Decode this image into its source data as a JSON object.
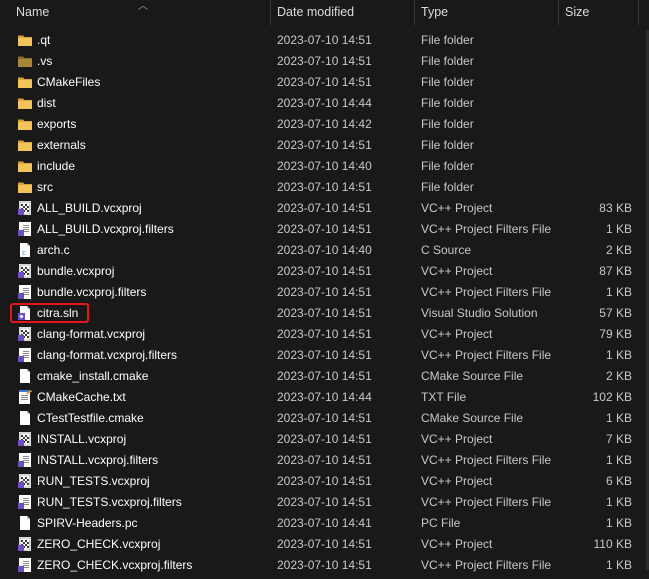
{
  "columns": {
    "name": "Name",
    "date": "Date modified",
    "type": "Type",
    "size": "Size"
  },
  "colors": {
    "folder": "#e8b84a",
    "highlight": "#e8141c",
    "vcxproj": "#6e4fc2"
  },
  "files": [
    {
      "name": ".qt",
      "date": "2023-07-10 14:51",
      "type": "File folder",
      "size": "",
      "icon": "folder-icon"
    },
    {
      "name": ".vs",
      "date": "2023-07-10 14:51",
      "type": "File folder",
      "size": "",
      "icon": "folder-dark-icon"
    },
    {
      "name": "CMakeFiles",
      "date": "2023-07-10 14:51",
      "type": "File folder",
      "size": "",
      "icon": "folder-icon"
    },
    {
      "name": "dist",
      "date": "2023-07-10 14:44",
      "type": "File folder",
      "size": "",
      "icon": "folder-icon"
    },
    {
      "name": "exports",
      "date": "2023-07-10 14:42",
      "type": "File folder",
      "size": "",
      "icon": "folder-icon"
    },
    {
      "name": "externals",
      "date": "2023-07-10 14:51",
      "type": "File folder",
      "size": "",
      "icon": "folder-icon"
    },
    {
      "name": "include",
      "date": "2023-07-10 14:40",
      "type": "File folder",
      "size": "",
      "icon": "folder-icon"
    },
    {
      "name": "src",
      "date": "2023-07-10 14:51",
      "type": "File folder",
      "size": "",
      "icon": "folder-icon"
    },
    {
      "name": "ALL_BUILD.vcxproj",
      "date": "2023-07-10 14:51",
      "type": "VC++ Project",
      "size": "83 KB",
      "icon": "vcxproj-icon"
    },
    {
      "name": "ALL_BUILD.vcxproj.filters",
      "date": "2023-07-10 14:51",
      "type": "VC++ Project Filters File",
      "size": "1 KB",
      "icon": "filters-icon"
    },
    {
      "name": "arch.c",
      "date": "2023-07-10 14:40",
      "type": "C Source",
      "size": "2 KB",
      "icon": "c-source-icon"
    },
    {
      "name": "bundle.vcxproj",
      "date": "2023-07-10 14:51",
      "type": "VC++ Project",
      "size": "87 KB",
      "icon": "vcxproj-icon"
    },
    {
      "name": "bundle.vcxproj.filters",
      "date": "2023-07-10 14:51",
      "type": "VC++ Project Filters File",
      "size": "1 KB",
      "icon": "filters-icon"
    },
    {
      "name": "citra.sln",
      "date": "2023-07-10 14:51",
      "type": "Visual Studio Solution",
      "size": "57 KB",
      "icon": "sln-icon"
    },
    {
      "name": "clang-format.vcxproj",
      "date": "2023-07-10 14:51",
      "type": "VC++ Project",
      "size": "79 KB",
      "icon": "vcxproj-icon"
    },
    {
      "name": "clang-format.vcxproj.filters",
      "date": "2023-07-10 14:51",
      "type": "VC++ Project Filters File",
      "size": "1 KB",
      "icon": "filters-icon"
    },
    {
      "name": "cmake_install.cmake",
      "date": "2023-07-10 14:51",
      "type": "CMake Source File",
      "size": "2 KB",
      "icon": "blank-file-icon"
    },
    {
      "name": "CMakeCache.txt",
      "date": "2023-07-10 14:44",
      "type": "TXT File",
      "size": "102 KB",
      "icon": "txt-file-icon"
    },
    {
      "name": "CTestTestfile.cmake",
      "date": "2023-07-10 14:51",
      "type": "CMake Source File",
      "size": "1 KB",
      "icon": "blank-file-icon"
    },
    {
      "name": "INSTALL.vcxproj",
      "date": "2023-07-10 14:51",
      "type": "VC++ Project",
      "size": "7 KB",
      "icon": "vcxproj-icon"
    },
    {
      "name": "INSTALL.vcxproj.filters",
      "date": "2023-07-10 14:51",
      "type": "VC++ Project Filters File",
      "size": "1 KB",
      "icon": "filters-icon"
    },
    {
      "name": "RUN_TESTS.vcxproj",
      "date": "2023-07-10 14:51",
      "type": "VC++ Project",
      "size": "6 KB",
      "icon": "vcxproj-icon"
    },
    {
      "name": "RUN_TESTS.vcxproj.filters",
      "date": "2023-07-10 14:51",
      "type": "VC++ Project Filters File",
      "size": "1 KB",
      "icon": "filters-icon"
    },
    {
      "name": "SPIRV-Headers.pc",
      "date": "2023-07-10 14:41",
      "type": "PC File",
      "size": "1 KB",
      "icon": "blank-file-icon"
    },
    {
      "name": "ZERO_CHECK.vcxproj",
      "date": "2023-07-10 14:51",
      "type": "VC++ Project",
      "size": "110 KB",
      "icon": "vcxproj-icon"
    },
    {
      "name": "ZERO_CHECK.vcxproj.filters",
      "date": "2023-07-10 14:51",
      "type": "VC++ Project Filters File",
      "size": "1 KB",
      "icon": "filters-icon"
    }
  ]
}
